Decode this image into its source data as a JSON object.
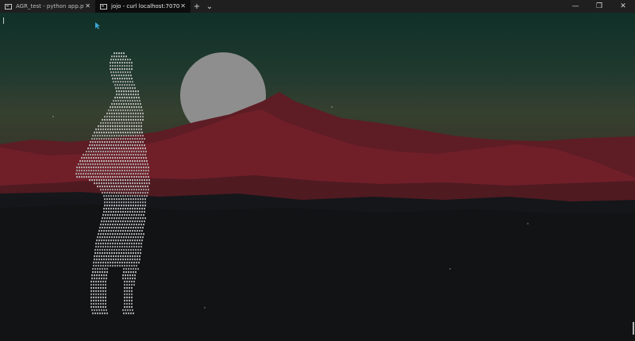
{
  "tabs": [
    {
      "title": "AGR_test - python  app.py -c fa",
      "active": false
    },
    {
      "title": "jojo - curl  localhost:7070",
      "active": true
    }
  ],
  "titlebar": {
    "new_tab_glyph": "+",
    "dropdown_glyph": "⌄",
    "close_glyph": "✕",
    "minimize_glyph": "—",
    "maximize_glyph": "❐",
    "window_close_glyph": "✕"
  },
  "colors": {
    "sky_top": "#0f3028",
    "sky_mid": "#2d4334",
    "moon": "#8e8e8e",
    "mountain_far": "#5c1a23",
    "mountain_near": "#761f2a",
    "ground": "#0c0d0f",
    "ascii": "#b9b9b9"
  }
}
